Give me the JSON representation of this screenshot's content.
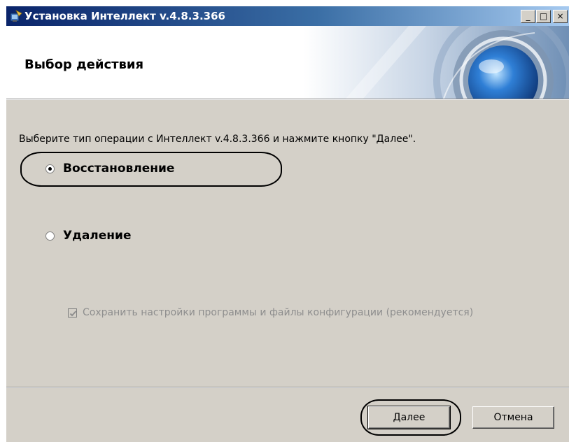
{
  "window": {
    "title": "Установка Интеллект v.4.8.3.366",
    "icon": "installer-icon",
    "controls": {
      "minimize": "_",
      "maximize": "□",
      "close": "×"
    }
  },
  "header": {
    "title": "Выбор действия",
    "art": "decorative-lens-graphic"
  },
  "main": {
    "instruction": "Выберите тип операции с Интеллект v.4.8.3.366 и нажмите кнопку \"Далее\".",
    "options": [
      {
        "label": "Восстановление",
        "selected": true
      },
      {
        "label": "Удаление",
        "selected": false
      }
    ],
    "checkbox": {
      "label": "Сохранить настройки программы и файлы конфигурации (рекомендуется)",
      "checked": true,
      "enabled": false
    }
  },
  "footer": {
    "next_label": "Далее",
    "cancel_label": "Отмена"
  },
  "colors": {
    "dialog_bg": "#d4d0c8",
    "title_gradient_start": "#0a246a",
    "title_gradient_end": "#a6caf0",
    "disabled_text": "#8e8e8e"
  }
}
